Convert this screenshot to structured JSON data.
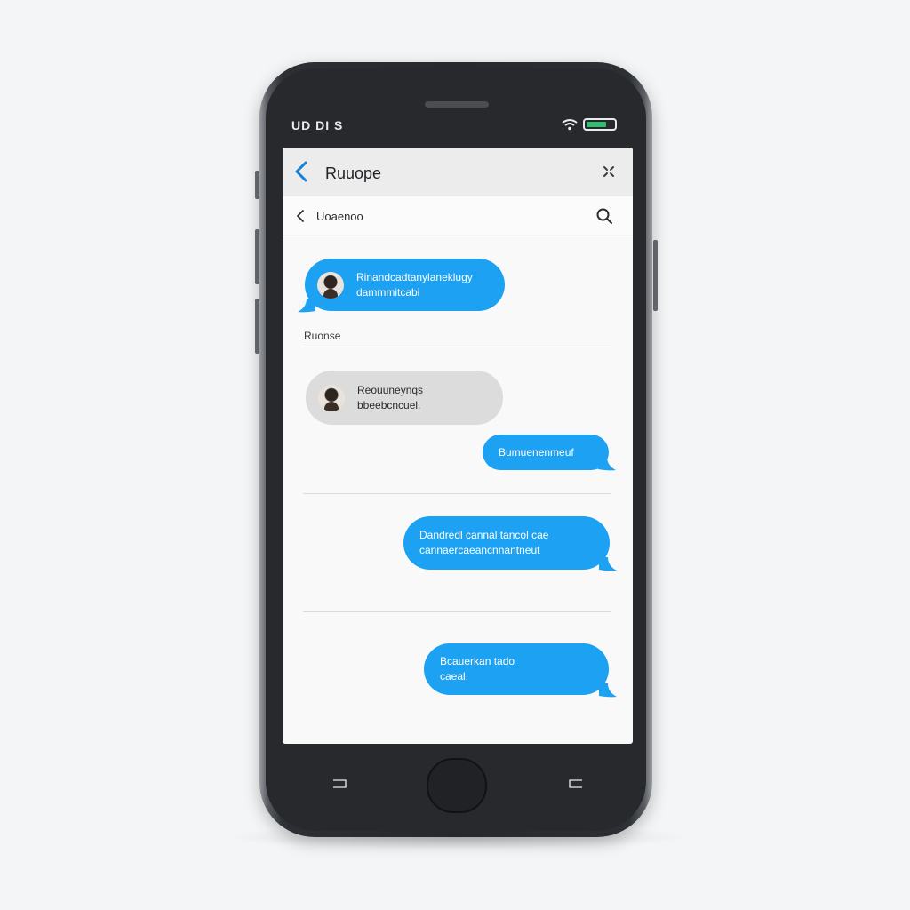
{
  "status_bar": {
    "carrier": "UD DI S",
    "wifi_icon": "wifi-icon",
    "battery_icon": "battery-icon"
  },
  "nav": {
    "back_icon": "chevron-left-icon",
    "title": "Ruuope",
    "close_icon": "close-icon"
  },
  "sub_header": {
    "back_icon": "chevron-left-icon",
    "title": "Uoaenoo",
    "search_icon": "search-icon"
  },
  "messages": [
    {
      "side": "incoming",
      "color": "blue",
      "has_avatar": true,
      "lines": [
        "Rinandcadtanylaneklugy",
        "dammmitcabi"
      ]
    },
    {
      "side": "incoming",
      "color": "gray",
      "has_avatar": true,
      "lines": [
        "Reouuneynqs",
        "bbeebcncuel."
      ]
    },
    {
      "side": "outgoing",
      "color": "blue",
      "has_avatar": false,
      "lines": [
        "Bumuenenmeuf"
      ]
    },
    {
      "side": "outgoing",
      "color": "blue",
      "has_avatar": false,
      "lines": [
        "Dandredl cannal tancol cae",
        "cannaercaeancnnantneut"
      ]
    },
    {
      "side": "outgoing",
      "color": "blue",
      "has_avatar": false,
      "lines": [
        "Bcauerkan tado",
        "caeal."
      ]
    }
  ],
  "section_label": "Ruonse",
  "colors": {
    "bubble_blue": "#1da1f2",
    "bubble_gray": "#dcdcdd",
    "screen_bg": "#f9f9f9",
    "phone_body": "#27292c"
  },
  "hardware": {
    "home_button": "home-button",
    "left_key": "recent-apps-icon",
    "right_key": "back-key-icon"
  }
}
